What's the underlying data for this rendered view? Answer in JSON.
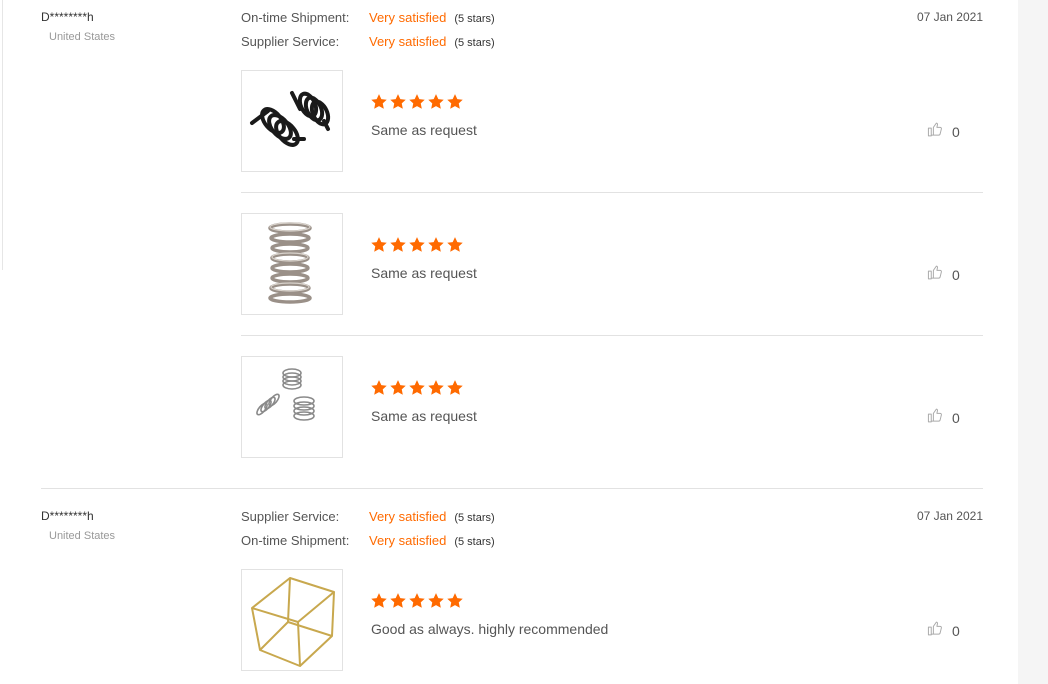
{
  "accent_color": "#ff6a00",
  "reviews": [
    {
      "buyer": "D********h",
      "country": "United States",
      "date": "07 Jan 2021",
      "ratings": [
        {
          "label": "On-time Shipment:",
          "value": "Very satisfied",
          "stars": "(5 stars)"
        },
        {
          "label": "Supplier Service:",
          "value": "Very satisfied",
          "stars": "(5 stars)"
        }
      ],
      "items": [
        {
          "image": "black-torsion-spring",
          "rating": 5,
          "comment": "Same as request",
          "likes": "0"
        },
        {
          "image": "steel-compression-spring",
          "rating": 5,
          "comment": "Same as request",
          "likes": "0"
        },
        {
          "image": "small-springs-set",
          "rating": 5,
          "comment": "Same as request",
          "likes": "0"
        }
      ]
    },
    {
      "buyer": "D********h",
      "country": "United States",
      "date": "07 Jan 2021",
      "ratings": [
        {
          "label": "Supplier Service:",
          "value": "Very satisfied",
          "stars": "(5 stars)"
        },
        {
          "label": "On-time Shipment:",
          "value": "Very satisfied",
          "stars": "(5 stars)"
        }
      ],
      "items": [
        {
          "image": "gold-wire-cube-frame",
          "rating": 5,
          "comment": "Good as always. highly recommended",
          "likes": "0"
        }
      ]
    }
  ]
}
